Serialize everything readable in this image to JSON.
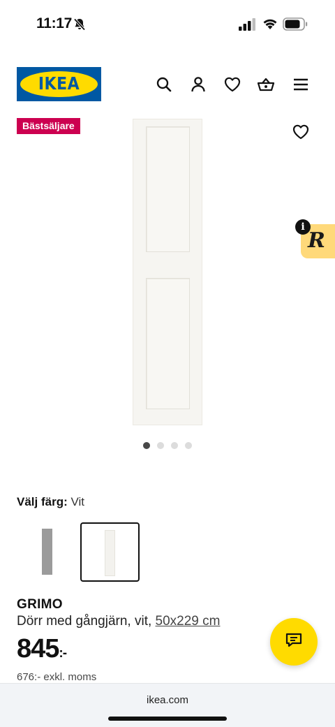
{
  "status_bar": {
    "time": "11:17"
  },
  "header": {
    "logo_text": "IKEA",
    "brand_blue": "#0058a3",
    "brand_yellow": "#ffdb00",
    "icons": [
      "search-icon",
      "profile-icon",
      "heart-icon",
      "basket-icon",
      "menu-icon"
    ]
  },
  "product": {
    "badge": "Bästsäljare",
    "badge_color": "#cc0050",
    "carousel": {
      "total": 4,
      "active": 1
    },
    "color_select": {
      "label": "Välj färg:",
      "value": "Vit",
      "options": [
        "grey",
        "white"
      ],
      "selected": "white"
    },
    "name": "GRIMO",
    "description": "Dörr med gångjärn, vit, ",
    "size": "50x229 cm",
    "price": "845",
    "price_suffix": ":-",
    "price_ex_vat": "676:- exkl. moms"
  },
  "extension": {
    "letter": "R",
    "info": "i"
  },
  "browser": {
    "url": "ikea.com"
  }
}
